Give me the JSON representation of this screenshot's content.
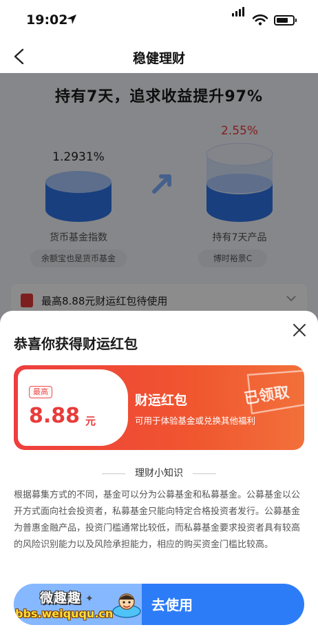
{
  "status_bar": {
    "time": "19:02"
  },
  "nav": {
    "title": "稳健理财"
  },
  "promo": {
    "headline": "持有7天，追求收益提升97%",
    "left": {
      "percent": "1.2931%",
      "caption": "货币基金指数",
      "chip": "余额宝也是货币基金"
    },
    "right": {
      "percent": "2.55%",
      "caption": "持有7天产品",
      "chip": "博时裕景C"
    },
    "coupon_row": "最高8.88元财运红包待使用"
  },
  "sheet": {
    "title": "恭喜你获得财运红包",
    "card": {
      "tag": "最高",
      "amount": "8.88",
      "unit": "元",
      "name": "财运红包",
      "desc": "可用于体验基金或兑换其他福利",
      "stamp": "已领取"
    },
    "tips_title": "理财小知识",
    "tips_body": "根据募集方式的不同，基金可以分为公募基金和私募基金。公募基金以公开方式面向社会投资者，私募基金只能向特定合格投资者发行。公募基金为普惠金融产品，投资门槛通常比较低，而私募基金要求投资者具有较高的风险识别能力以及风险承担能力，相应的购买资金门槛比较高。",
    "cta_label": "去使用",
    "watermark": {
      "cn": "微趣趣",
      "url": "bbs.weiququ.cn"
    }
  },
  "colors": {
    "accent_red": "#e93b3b",
    "cta_blue": "#2d7cf7",
    "overlay": "rgba(0,0,0,0.45)"
  }
}
